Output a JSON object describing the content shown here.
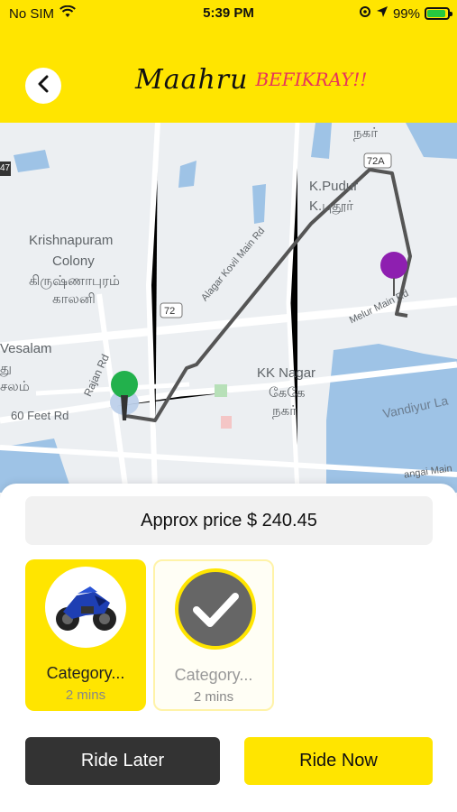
{
  "status_bar": {
    "carrier": "No SIM",
    "time": "5:39 PM",
    "battery": "99%"
  },
  "header": {
    "logo_main": "Maahru",
    "logo_accent": "BEFIKRAY!!"
  },
  "map": {
    "labels": {
      "krishnapuram": "Krishnapuram",
      "colony": "Colony",
      "krishnapuram_tamil": "கிருஷ்ணாபுரம்",
      "colony_tamil": "காலனி",
      "vesalam": "Vesalam",
      "vesalam_tamil_1": "து",
      "vesalam_tamil_2": "சலம்",
      "kpudur": "K.Pudur",
      "kpudur_tamil": "K.புதூர்",
      "nagar_tamil_top": "நகர்",
      "kk_nagar": "KK Nagar",
      "kk_nagar_tamil_1": "கேகே",
      "kk_nagar_tamil_2": "நகர்",
      "vandiyur": "Vandiyur La",
      "feet_rd": "60 Feet Rd",
      "rajan_rd": "Rajan Rd",
      "alagar_rd": "Alagar Kovil Main Rd",
      "melur_rd": "Melur Main Rd",
      "gangai_main": "angai Main",
      "shield_72": "72",
      "shield_72a": "72A",
      "shield_edge": "47"
    },
    "colors": {
      "route": "#555555",
      "origin_pin": "#22b14c",
      "destination_pin": "#8e1fb0",
      "water": "#9ec3e6"
    }
  },
  "booking": {
    "price_text": "Approx price $ 240.45",
    "categories": [
      {
        "title": "Category...",
        "time": "2 mins",
        "selected": true,
        "icon": "motorbike-image"
      },
      {
        "title": "Category...",
        "time": "2 mins",
        "selected": false,
        "icon": "checkmark-icon"
      }
    ],
    "ride_later_label": "Ride Later",
    "ride_now_label": "Ride Now"
  },
  "colors": {
    "accent": "#ffe500",
    "dark_button": "#333333"
  }
}
